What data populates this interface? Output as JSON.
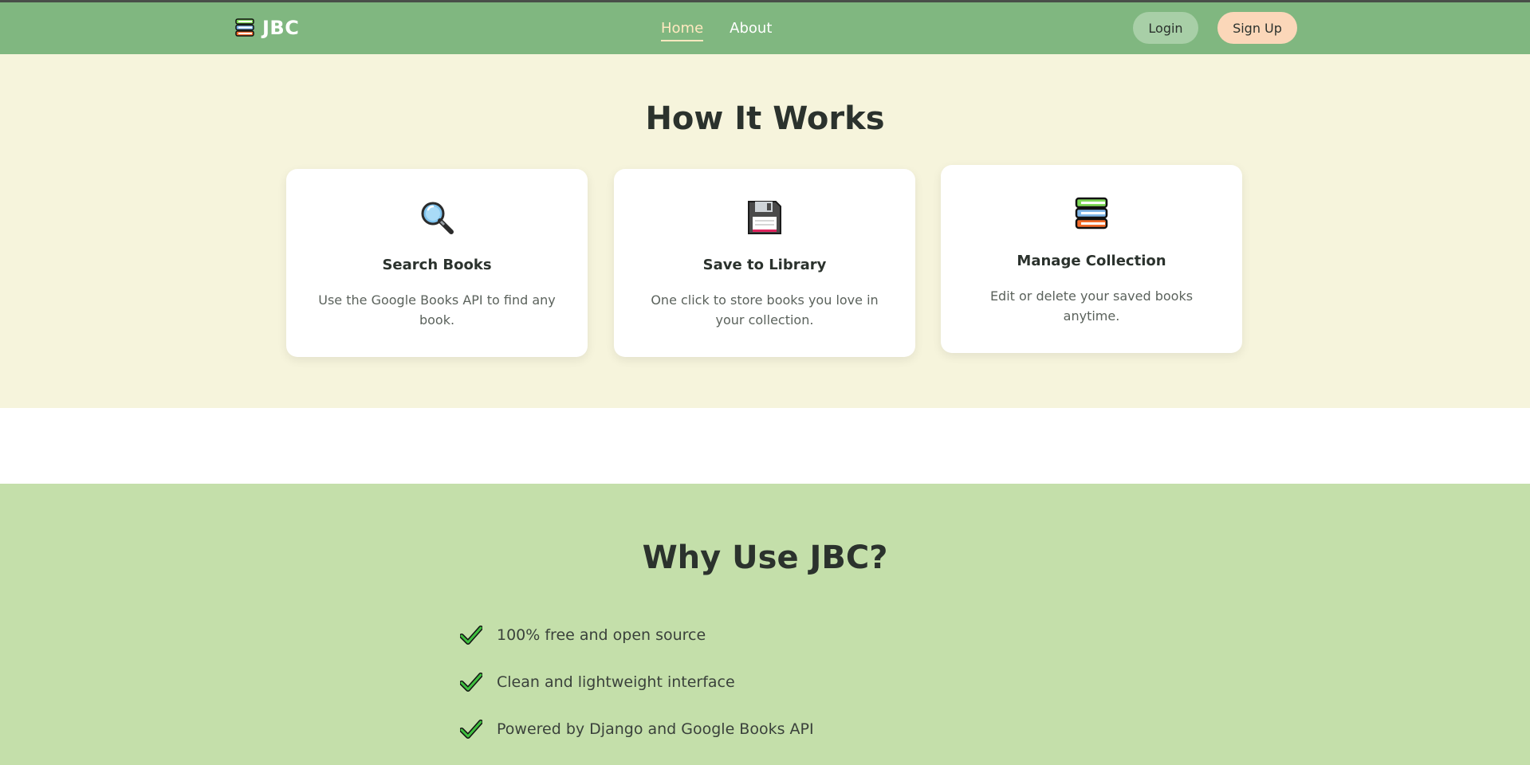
{
  "navbar": {
    "brand": "JBC",
    "brand_icon": "books-stack-icon",
    "links": [
      {
        "label": "Home",
        "active": true
      },
      {
        "label": "About",
        "active": false
      }
    ],
    "login_label": "Login",
    "signup_label": "Sign Up"
  },
  "how": {
    "title": "How It Works",
    "cards": [
      {
        "icon": "magnifier-icon",
        "title": "Search Books",
        "desc": "Use the Google Books API to find any book."
      },
      {
        "icon": "floppy-disk-icon",
        "title": "Save to Library",
        "desc": "One click to store books you love in your collection."
      },
      {
        "icon": "books-stack-icon",
        "title": "Manage Collection",
        "desc": "Edit or delete your saved books anytime."
      }
    ]
  },
  "why": {
    "title": "Why Use JBC?",
    "items": [
      "100% free and open source",
      "Clean and lightweight interface",
      "Powered by Django and Google Books API"
    ]
  },
  "colors": {
    "navbar": "#80b780",
    "how_bg": "#f6f4dc",
    "why_bg": "#c4dfaa",
    "accent_active": "#ffe9c0",
    "login_bg": "#a8cfa7",
    "signup_bg": "#fbd7b9"
  }
}
